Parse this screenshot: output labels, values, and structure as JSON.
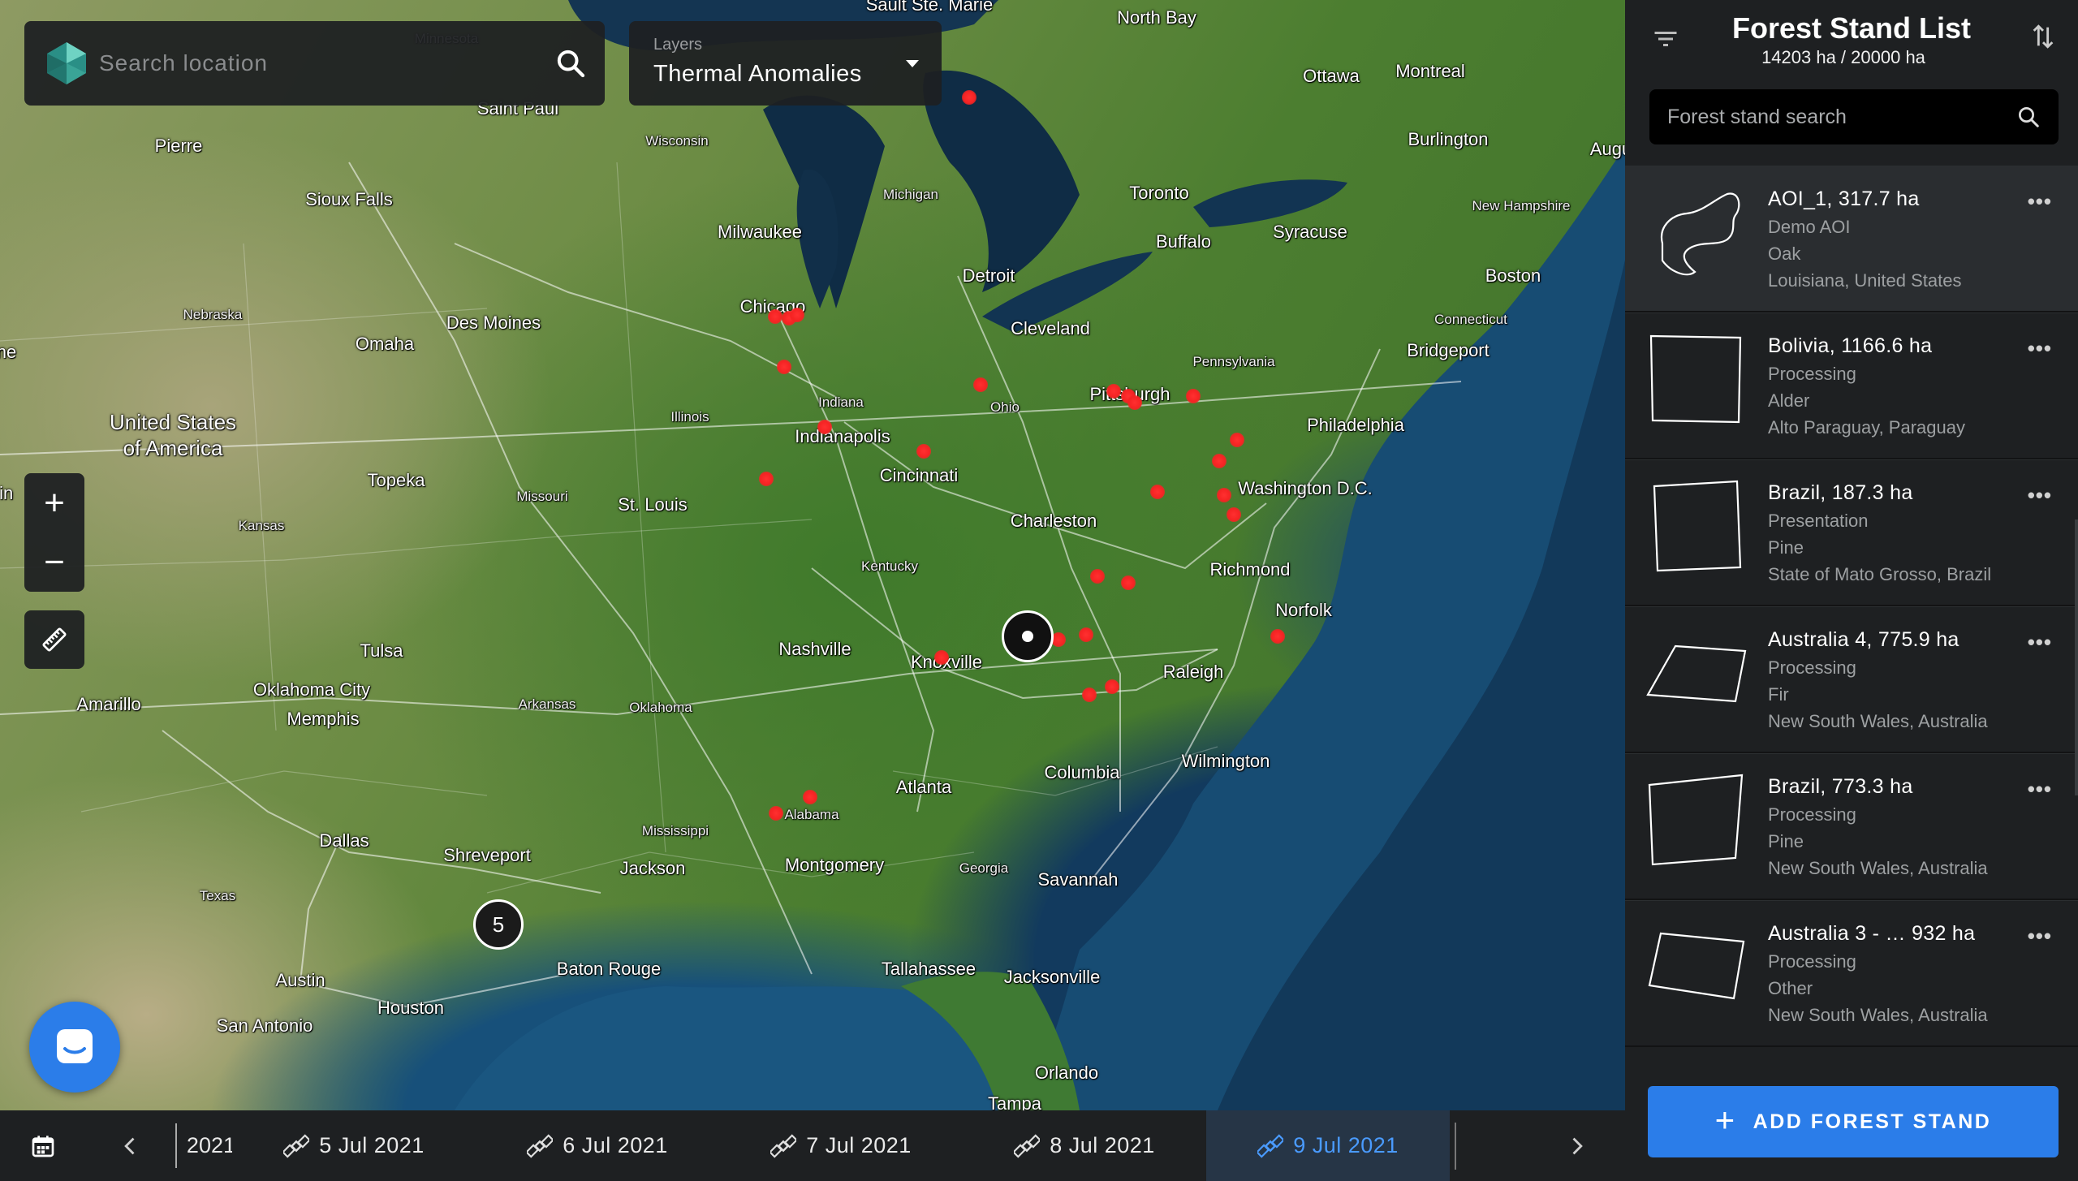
{
  "map": {
    "search_placeholder": "Search location",
    "layers_label": "Layers",
    "layers_value": "Thermal Anomalies",
    "zoom_in": "+",
    "zoom_out": "−",
    "cluster_count": "5",
    "cities": [
      {
        "name": "Sault Ste. Marie",
        "kind": "city"
      },
      {
        "name": "North Bay",
        "kind": "city"
      },
      {
        "name": "Minnesota",
        "kind": "state"
      },
      {
        "name": "Ottawa",
        "kind": "city"
      },
      {
        "name": "Montreal",
        "kind": "city"
      },
      {
        "name": "Augus",
        "kind": "city"
      },
      {
        "name": "Saint Paul",
        "kind": "city"
      },
      {
        "name": "Pierre",
        "kind": "city"
      },
      {
        "name": "Wisconsin",
        "kind": "state"
      },
      {
        "name": "Burlington",
        "kind": "city"
      },
      {
        "name": "Sioux Falls",
        "kind": "city"
      },
      {
        "name": "Milwaukee",
        "kind": "city"
      },
      {
        "name": "Michigan",
        "kind": "state"
      },
      {
        "name": "Toronto",
        "kind": "city"
      },
      {
        "name": "New Hampshire",
        "kind": "state"
      },
      {
        "name": "Syracuse",
        "kind": "city"
      },
      {
        "name": "Buffalo",
        "kind": "city"
      },
      {
        "name": "Boston",
        "kind": "city"
      },
      {
        "name": "Detroit",
        "kind": "city"
      },
      {
        "name": "Nebraska",
        "kind": "state"
      },
      {
        "name": "Des Moines",
        "kind": "city"
      },
      {
        "name": "Chicago",
        "kind": "city"
      },
      {
        "name": "Connecticut",
        "kind": "state"
      },
      {
        "name": "Cleveland",
        "kind": "city"
      },
      {
        "name": "Omaha",
        "kind": "city"
      },
      {
        "name": "Bridgeport",
        "kind": "city"
      },
      {
        "name": "Pennsylvania",
        "kind": "state"
      },
      {
        "name": "Pittsburgh",
        "kind": "city"
      },
      {
        "name": "Indiana",
        "kind": "state"
      },
      {
        "name": "Ohio",
        "kind": "state"
      },
      {
        "name": "Illinois",
        "kind": "state"
      },
      {
        "name": "Philadelphia",
        "kind": "city"
      },
      {
        "name": "Indianapolis",
        "kind": "city"
      },
      {
        "name": "Cincinnati",
        "kind": "city"
      },
      {
        "name": "Topeka",
        "kind": "city"
      },
      {
        "name": "Washington D.C.",
        "kind": "city"
      },
      {
        "name": "Missouri",
        "kind": "state"
      },
      {
        "name": "St. Louis",
        "kind": "city"
      },
      {
        "name": "Charleston",
        "kind": "city"
      },
      {
        "name": "Kansas",
        "kind": "state"
      },
      {
        "name": "Richmond",
        "kind": "city"
      },
      {
        "name": "Kentucky",
        "kind": "state"
      },
      {
        "name": "Norfolk",
        "kind": "city"
      },
      {
        "name": "Tulsa",
        "kind": "city"
      },
      {
        "name": "Nashville",
        "kind": "city"
      },
      {
        "name": "Knoxville",
        "kind": "city"
      },
      {
        "name": "Raleigh",
        "kind": "city"
      },
      {
        "name": "Amarillo",
        "kind": "city"
      },
      {
        "name": "Oklahoma City",
        "kind": "city"
      },
      {
        "name": "Arkansas",
        "kind": "state"
      },
      {
        "name": "Memphis",
        "kind": "city"
      },
      {
        "name": "Oklahoma",
        "kind": "state"
      },
      {
        "name": "Wilmington",
        "kind": "city"
      },
      {
        "name": "Columbia",
        "kind": "city"
      },
      {
        "name": "Atlanta",
        "kind": "city"
      },
      {
        "name": "Alabama",
        "kind": "state"
      },
      {
        "name": "Mississippi",
        "kind": "state"
      },
      {
        "name": "Dallas",
        "kind": "city"
      },
      {
        "name": "Shreveport",
        "kind": "city"
      },
      {
        "name": "Jackson",
        "kind": "city"
      },
      {
        "name": "Montgomery",
        "kind": "city"
      },
      {
        "name": "Georgia",
        "kind": "state"
      },
      {
        "name": "Savannah",
        "kind": "city"
      },
      {
        "name": "Texas",
        "kind": "state"
      },
      {
        "name": "Baton Rouge",
        "kind": "city"
      },
      {
        "name": "Tallahassee",
        "kind": "city"
      },
      {
        "name": "Jacksonville",
        "kind": "city"
      },
      {
        "name": "Austin",
        "kind": "city"
      },
      {
        "name": "Houston",
        "kind": "city"
      },
      {
        "name": "San Antonio",
        "kind": "city"
      },
      {
        "name": "Orlando",
        "kind": "city"
      },
      {
        "name": "Tampa",
        "kind": "city"
      },
      {
        "name": "rin",
        "kind": "city"
      },
      {
        "name": "ne",
        "kind": "city"
      }
    ],
    "country_label_line1": "United States",
    "country_label_line2": "of America"
  },
  "timeline": {
    "partial_date": "2021",
    "dates": [
      {
        "label": "5 Jul 2021",
        "active": false
      },
      {
        "label": "6 Jul 2021",
        "active": false
      },
      {
        "label": "7 Jul 2021",
        "active": false
      },
      {
        "label": "8 Jul 2021",
        "active": false
      },
      {
        "label": "9 Jul 2021",
        "active": true
      }
    ]
  },
  "sidebar": {
    "title": "Forest Stand List",
    "summary": "14203 ha / 20000 ha",
    "search_placeholder": "Forest stand search",
    "add_button": "ADD FOREST STAND",
    "more": "•••",
    "stands": [
      {
        "name": "AOI_1, 317.7 ha",
        "status": "Demo AOI",
        "species": "Oak",
        "location": "Louisiana, United States",
        "shape": "aoi"
      },
      {
        "name": "Bolivia, 1166.6 ha",
        "status": "Processing",
        "species": "Alder",
        "location": "Alto Paraguay, Paraguay",
        "shape": "square1"
      },
      {
        "name": "Brazil, 187.3 ha",
        "status": "Presentation",
        "species": "Pine",
        "location": "State of Mato Grosso, Brazil",
        "shape": "square2"
      },
      {
        "name": "Australia 4, 775.9 ha",
        "status": "Processing",
        "species": "Fir",
        "location": "New South Wales, Australia",
        "shape": "para"
      },
      {
        "name": "Brazil, 773.3 ha",
        "status": "Processing",
        "species": "Pine",
        "location": "New South Wales, Australia",
        "shape": "square3"
      },
      {
        "name": "Australia 3 - …  932 ha",
        "status": "Processing",
        "species": "Other",
        "location": "New South Wales, Australia",
        "shape": "quad"
      }
    ]
  },
  "colors": {
    "accent": "#2b7de9",
    "active_date": "#4a9bff",
    "hotspot": "#f52323",
    "panel": "#1e2022"
  }
}
